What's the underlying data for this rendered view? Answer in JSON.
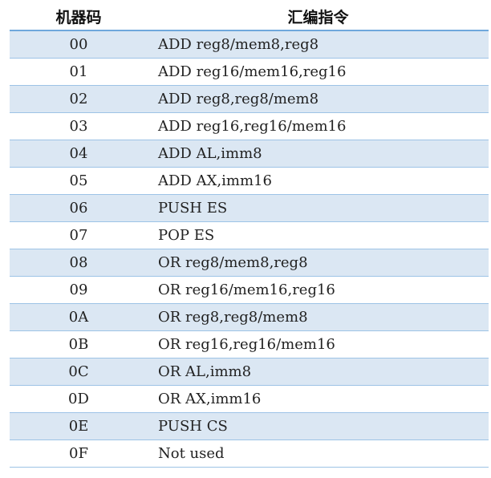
{
  "table": {
    "headers": {
      "code": "机器码",
      "asm": "汇编指令"
    },
    "rows": [
      {
        "code": "00",
        "asm": "ADD reg8/mem8,reg8"
      },
      {
        "code": "01",
        "asm": "ADD reg16/mem16,reg16"
      },
      {
        "code": "02",
        "asm": "ADD reg8,reg8/mem8"
      },
      {
        "code": "03",
        "asm": "ADD reg16,reg16/mem16"
      },
      {
        "code": "04",
        "asm": "ADD AL,imm8"
      },
      {
        "code": "05",
        "asm": "ADD AX,imm16"
      },
      {
        "code": "06",
        "asm": "PUSH ES"
      },
      {
        "code": "07",
        "asm": "POP ES"
      },
      {
        "code": "08",
        "asm": "OR reg8/mem8,reg8"
      },
      {
        "code": "09",
        "asm": "OR reg16/mem16,reg16"
      },
      {
        "code": "0A",
        "asm": "OR reg8,reg8/mem8"
      },
      {
        "code": "0B",
        "asm": "OR reg16,reg16/mem16"
      },
      {
        "code": "0C",
        "asm": "OR AL,imm8"
      },
      {
        "code": "0D",
        "asm": "OR AX,imm16"
      },
      {
        "code": "0E",
        "asm": "PUSH CS"
      },
      {
        "code": "0F",
        "asm": "Not used"
      }
    ]
  },
  "colors": {
    "band": "#dbe7f3",
    "rule": "#9dc3e6",
    "header_rule": "#6fa8dc"
  }
}
